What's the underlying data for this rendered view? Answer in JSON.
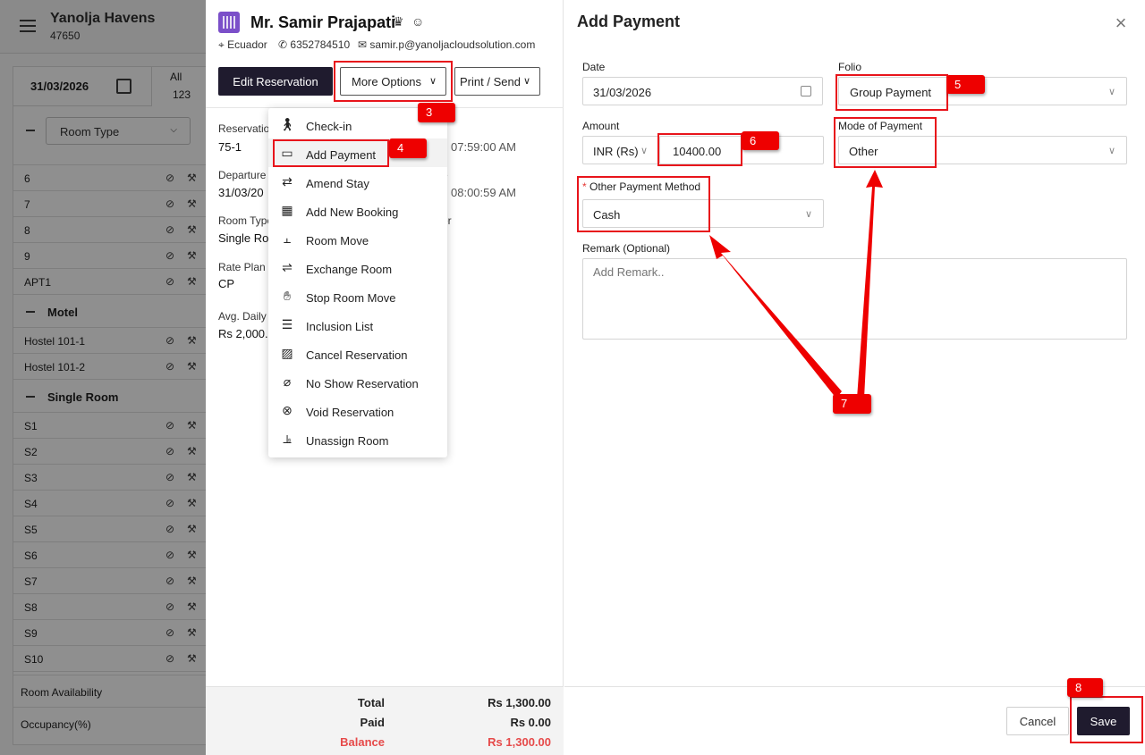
{
  "background_app": {
    "hotel_name": "Yanolja Havens",
    "hotel_id": "47650",
    "date": "31/03/2026",
    "all_label": "All",
    "all_count": "123",
    "room_type_filter": "Room Type",
    "rows_top": [
      "6",
      "7",
      "8",
      "9",
      "APT1"
    ],
    "group_motel": "Motel",
    "rows_motel": [
      "Hostel 101-1",
      "Hostel 101-2"
    ],
    "group_single": "Single Room",
    "rows_single": [
      "S1",
      "S2",
      "S3",
      "S4",
      "S5",
      "S6",
      "S7",
      "S8",
      "S9",
      "S10"
    ],
    "footer_availability": "Room Availability",
    "footer_occupancy": "Occupancy(%)"
  },
  "reservation": {
    "guest_name": "Mr. Samir Prajapati",
    "country": "Ecuador",
    "phone": "6352784510",
    "email": "samir.p@yanoljacloudsolution.com",
    "edit_button": "Edit Reservation",
    "more_options_button": "More Options",
    "print_button": "Print / Send",
    "reservation_label": "Reservatio",
    "reservation_value": "75-1",
    "arrival_time": "07:59:00 AM",
    "departure_label": "Departure",
    "departure_value": "31/03/20",
    "departure_suffix": "e",
    "departure_time": "08:00:59 AM",
    "room_type_label": "Room Type",
    "room_type_suffix": "er",
    "room_type_value": "Single Roo",
    "rate_plan_label": "Rate Plan",
    "rate_plan_value": "CP",
    "avg_daily_label": "Avg. Daily",
    "avg_daily_value": "Rs 2,000.0",
    "total_label": "Total",
    "total_value": "Rs 1,300.00",
    "paid_label": "Paid",
    "paid_value": "Rs 0.00",
    "balance_label": "Balance",
    "balance_value": "Rs 1,300.00"
  },
  "menu": {
    "items": [
      {
        "label": "Check-in",
        "icon": "check-in-icon"
      },
      {
        "label": "Add Payment",
        "icon": "payment-card-icon"
      },
      {
        "label": "Amend Stay",
        "icon": "amend-calendar-icon"
      },
      {
        "label": "Add New Booking",
        "icon": "calendar-icon"
      },
      {
        "label": "Room Move",
        "icon": "bed-move-icon"
      },
      {
        "label": "Exchange Room",
        "icon": "bed-exchange-icon"
      },
      {
        "label": "Stop Room Move",
        "icon": "hand-stop-icon"
      },
      {
        "label": "Inclusion List",
        "icon": "inclusion-icon"
      },
      {
        "label": "Cancel Reservation",
        "icon": "calendar-cancel-icon"
      },
      {
        "label": "No Show Reservation",
        "icon": "eye-off-icon"
      },
      {
        "label": "Void Reservation",
        "icon": "circle-x-icon"
      },
      {
        "label": "Unassign Room",
        "icon": "bed-unassign-icon"
      }
    ]
  },
  "payment": {
    "title": "Add Payment",
    "date_label": "Date",
    "date_value": "31/03/2026",
    "folio_label": "Folio",
    "folio_value": "Group Payment",
    "amount_label": "Amount",
    "currency_value": "INR (Rs)",
    "amount_value": "10400.00",
    "mode_label": "Mode of Payment",
    "mode_value": "Other",
    "other_method_required": "*",
    "other_method_label": "Other Payment Method",
    "other_method_value": "Cash",
    "remark_label": "Remark (Optional)",
    "remark_placeholder": "Add Remark..",
    "cancel_button": "Cancel",
    "save_button": "Save"
  },
  "annotations": {
    "step3": "3",
    "step4": "4",
    "step5": "5",
    "step6": "6",
    "step7": "7",
    "step8": "8",
    "color": "#e8141b"
  }
}
